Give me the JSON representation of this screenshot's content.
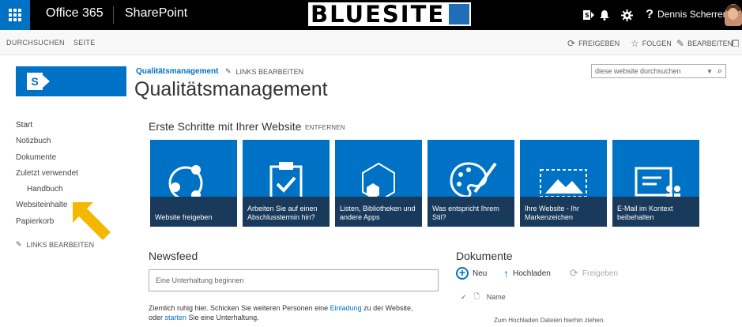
{
  "suitebar": {
    "brand": "Office 365",
    "app": "SharePoint",
    "logo_text": "BLUESITE",
    "user": "Dennis Scherrer",
    "icons": [
      "waffle-icon",
      "sharepoint-icon",
      "bell-icon",
      "gear-icon",
      "help-icon"
    ],
    "help_glyph": "?",
    "accent": "#0072c6"
  },
  "ribbon": {
    "browse": "DURCHSUCHEN",
    "page": "SEITE",
    "share": "FREIGEBEN",
    "follow": "FOLGEN",
    "edit": "BEARBEITEN"
  },
  "header": {
    "breadcrumb": "Qualitätsmanagement",
    "edit_links": "LINKS BEARBEITEN",
    "title": "Qualitätsmanagement",
    "search_placeholder": "diese website durchsuchen"
  },
  "leftnav": {
    "items": [
      {
        "label": "Start"
      },
      {
        "label": "Notizbuch"
      },
      {
        "label": "Dokumente"
      },
      {
        "label": "Zuletzt verwendet"
      },
      {
        "label": "Handbuch"
      },
      {
        "label": "Websiteinhalte"
      },
      {
        "label": "Papierkorb"
      }
    ],
    "edit_links": "LINKS BEARBEITEN"
  },
  "getting_started": {
    "title": "Erste Schritte mit Ihrer Website",
    "remove": "ENTFERNEN",
    "tiles": [
      {
        "label": "Website freigeben",
        "icon": "share-icon"
      },
      {
        "label": "Arbeiten Sie auf einen Abschlusstermin hin?",
        "icon": "clipboard-check-icon"
      },
      {
        "label": "Listen, Bibliotheken und andere Apps",
        "icon": "hexagon-icon"
      },
      {
        "label": "Was entspricht Ihrem Stil?",
        "icon": "palette-icon"
      },
      {
        "label": "Ihre Website - Ihr Markenzeichen",
        "icon": "picture-icon"
      },
      {
        "label": "E-Mail im Kontext beibehalten",
        "icon": "email-group-icon"
      }
    ]
  },
  "newsfeed": {
    "title": "Newsfeed",
    "input_placeholder": "Eine Unterhaltung beginnen",
    "text_1": "Ziemlich ruhig hier. Schicken Sie weiteren Personen eine ",
    "link_1": "Einladung",
    "text_2": " zu der Website,",
    "text_3": "oder ",
    "link_2": "starten",
    "text_4": " Sie eine Unterhaltung."
  },
  "documents": {
    "title": "Dokumente",
    "new": "Neu",
    "upload": "Hochladen",
    "share": "Freigeben",
    "column_name": "Name",
    "drop_hint": "Zum Hochladen Dateien hierhin ziehen."
  }
}
